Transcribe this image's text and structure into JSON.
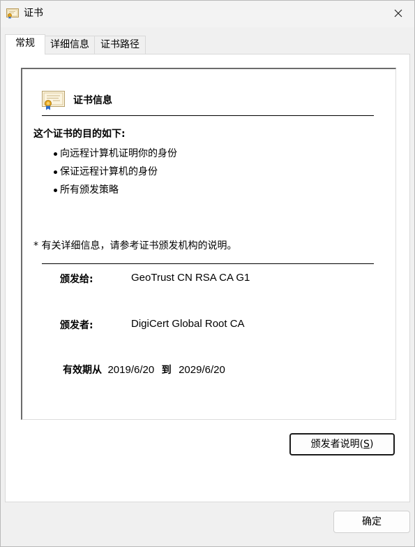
{
  "window": {
    "title": "证书",
    "title_icon": "certificate-icon",
    "close_icon": "close-icon"
  },
  "tabs": [
    {
      "label": "常规",
      "active": true
    },
    {
      "label": "详细信息",
      "active": false
    },
    {
      "label": "证书路径",
      "active": false
    }
  ],
  "general": {
    "heading_icon": "certificate-icon",
    "heading": "证书信息",
    "purpose_heading": "这个证书的目的如下:",
    "purposes": [
      "向远程计算机证明你的身份",
      "保证远程计算机的身份",
      "所有颁发策略"
    ],
    "note": "* 有关详细信息，请参考证书颁发机构的说明。",
    "issued_to_label": "颁发给:",
    "issued_to_value": "GeoTrust CN RSA CA G1",
    "issued_by_label": "颁发者:",
    "issued_by_value": "DigiCert Global Root CA",
    "validity_label": "有效期从",
    "valid_from": "2019/6/20",
    "validity_to_label": "到",
    "valid_to": "2029/6/20"
  },
  "buttons": {
    "issuer_statement_prefix": "颁发者说明(",
    "issuer_statement_accel": "S",
    "issuer_statement_suffix": ")",
    "ok": "确定"
  },
  "colors": {
    "window_bg": "#f0f0f0",
    "page_bg": "#ffffff",
    "border": "#d9d9d9",
    "focus_border": "#1a1a1a"
  }
}
